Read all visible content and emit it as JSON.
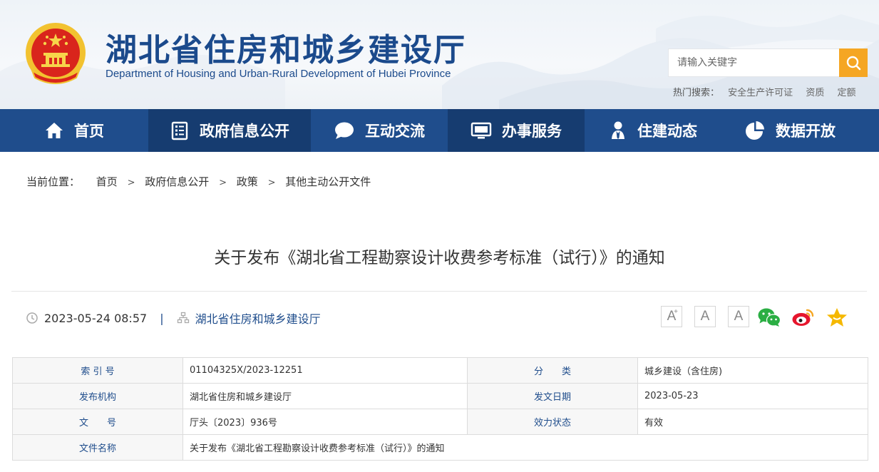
{
  "header": {
    "title": "湖北省住房和城乡建设厅",
    "subtitle": "Department of Housing and Urban-Rural Development of Hubei Province",
    "search_placeholder": "请输入关键字",
    "hot_label": "热门搜索：",
    "hot_terms": [
      "安全生产许可证",
      "资质",
      "定额"
    ]
  },
  "nav": [
    {
      "label": "首页",
      "icon": "home-icon"
    },
    {
      "label": "政府信息公开",
      "icon": "document-list-icon"
    },
    {
      "label": "互动交流",
      "icon": "chat-bubble-icon"
    },
    {
      "label": "办事服务",
      "icon": "monitor-icon"
    },
    {
      "label": "住建动态",
      "icon": "person-icon"
    },
    {
      "label": "数据开放",
      "icon": "pie-chart-icon"
    }
  ],
  "breadcrumb": {
    "label": "当前位置：",
    "items": [
      "首页",
      "政府信息公开",
      "政策",
      "其他主动公开文件"
    ],
    "separator": ">"
  },
  "article": {
    "title": "关于发布《湖北省工程勘察设计收费参考标准（试行）》的通知",
    "datetime": "2023-05-24 08:57",
    "meta_separator": "|",
    "source": "湖北省住房和城乡建设厅",
    "font_sizes": [
      "A",
      "A",
      "A"
    ],
    "font_plus": "+"
  },
  "info_table": {
    "rows": [
      {
        "k1": "索 引 号",
        "v1": "01104325X/2023-12251",
        "k2": "分　　类",
        "v2": "城乡建设（含住房)"
      },
      {
        "k1": "发布机构",
        "v1": "湖北省住房和城乡建设厅",
        "k2": "发文日期",
        "v2": "2023-05-23"
      },
      {
        "k1": "文　　号",
        "v1": "厅头〔2023〕936号",
        "k2": "效力状态",
        "v2": "有效"
      }
    ],
    "name_key": "文件名称",
    "name_value": "关于发布《湖北省工程勘察设计收费参考标准（试行）》的通知"
  },
  "colors": {
    "brand": "#1f4d8c",
    "nav_active": "#163c70",
    "search_button": "#f5a623",
    "wechat": "#2aae43",
    "weibo": "#e6162d",
    "favorite": "#f5b800"
  }
}
